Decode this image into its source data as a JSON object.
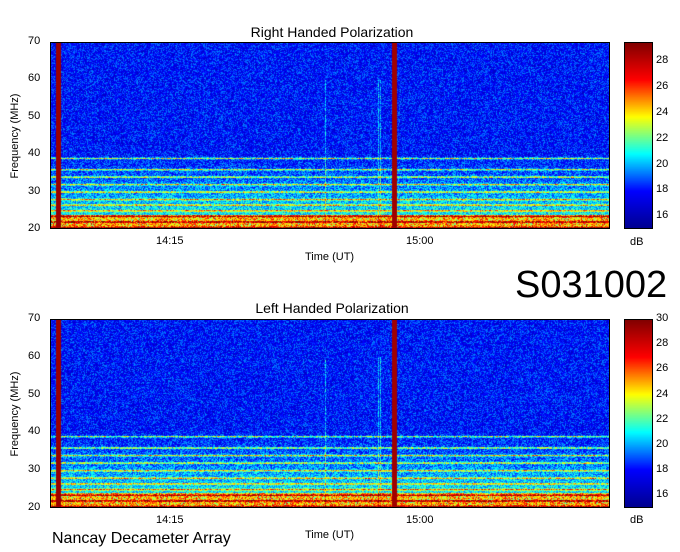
{
  "dataset_id": "S031002",
  "footer": "Nancay Decameter Array",
  "chart_data": [
    {
      "type": "heatmap",
      "title": "Right Handed Polarization",
      "xlabel": "Time (UT)",
      "ylabel": "Frequency (MHz)",
      "x_ticks": [
        "14:15",
        "15:00"
      ],
      "y_ticks": [
        20,
        30,
        40,
        50,
        60,
        70
      ],
      "ylim": [
        20,
        70
      ],
      "colorbar": {
        "label": "dB",
        "ticks": [
          16,
          18,
          20,
          22,
          24,
          26,
          28
        ],
        "range": [
          15,
          29.5
        ]
      },
      "colormap": [
        "#00008f",
        "#0000ff",
        "#00ffff",
        "#ffff00",
        "#ff0000",
        "#800000"
      ]
    },
    {
      "type": "heatmap",
      "title": "Left Handed Polarization",
      "xlabel": "Time (UT)",
      "ylabel": "Frequency (MHz)",
      "x_ticks": [
        "14:15",
        "15:00"
      ],
      "y_ticks": [
        20,
        30,
        40,
        50,
        60,
        70
      ],
      "ylim": [
        20,
        70
      ],
      "colorbar": {
        "label": "dB",
        "ticks": [
          16,
          18,
          20,
          22,
          24,
          26,
          28,
          30
        ],
        "range": [
          15,
          30
        ]
      },
      "colormap": [
        "#00008f",
        "#0000ff",
        "#00ffff",
        "#ffff00",
        "#ff0000",
        "#800000"
      ]
    }
  ]
}
